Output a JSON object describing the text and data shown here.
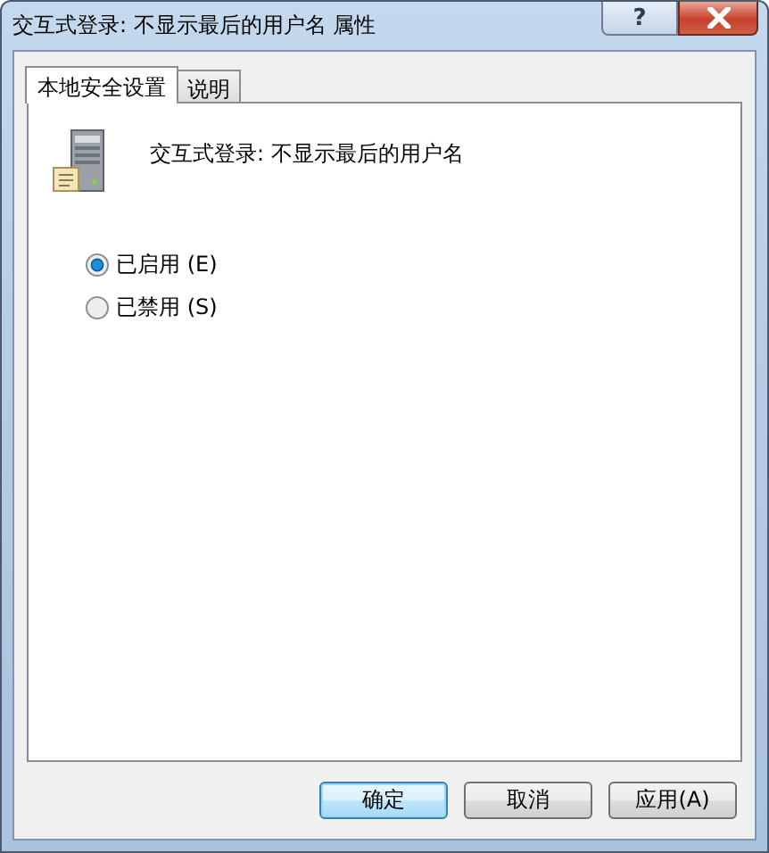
{
  "window": {
    "title": "交互式登录: 不显示最后的用户名 属性",
    "help_button": "?"
  },
  "tabs": [
    {
      "label": "本地安全设置",
      "selected": true
    },
    {
      "label": "说明",
      "selected": false
    }
  ],
  "policy": {
    "title": "交互式登录: 不显示最后的用户名"
  },
  "options": [
    {
      "label": "已启用 (E)",
      "selected": true
    },
    {
      "label": "已禁用 (S)",
      "selected": false
    }
  ],
  "buttons": [
    {
      "label": "确定",
      "default": true
    },
    {
      "label": "取消",
      "default": false
    },
    {
      "label": "应用(A)",
      "default": false
    }
  ]
}
